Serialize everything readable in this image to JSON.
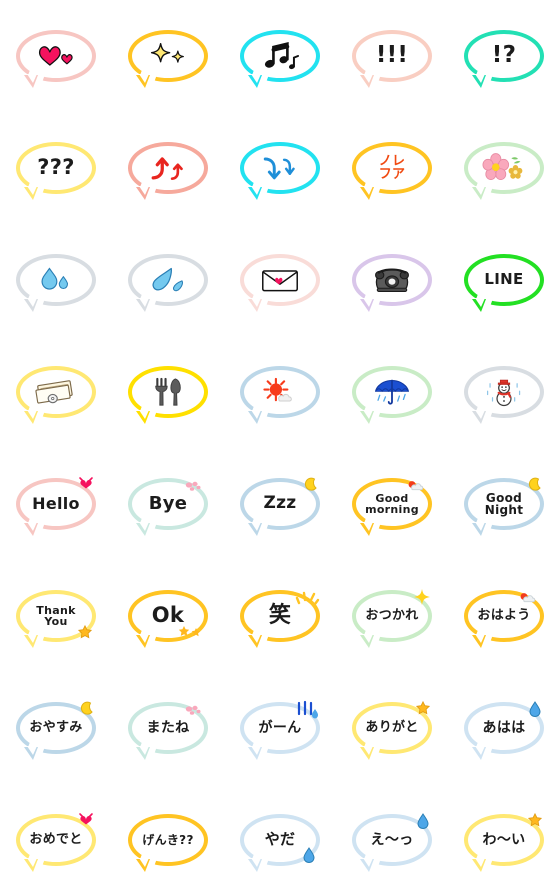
{
  "page": {
    "title": "Speech Bubble Emoji Set",
    "columns": 5,
    "rows": 8,
    "background": "#ffffff"
  },
  "palette": {
    "pink": "#f7c6c2",
    "yellow": "#ffc423",
    "cyan": "#22e2f0",
    "peach": "#f9cec2",
    "mint": "#23e0b4",
    "pale_yellow": "#ffe873",
    "salmon": "#f6a99c",
    "orange": "#f5a623",
    "pale_green": "#c9ecc6",
    "grey": "#d8dde2",
    "lavender": "#d9c6ea",
    "green": "#23e023",
    "blue_grey": "#bcd7e8",
    "sky": "#cfe3f2",
    "red": "#e8251f",
    "heart_pink": "#f5125e",
    "drop_blue": "#74c9ef",
    "note_black": "#111111",
    "star_yellow": "#ffd21e",
    "text_black": "#1c1c1c",
    "umbrella_blue": "#1b4fd1",
    "sun_red": "#f73b1b"
  },
  "stickers": [
    {
      "row": 1,
      "col": 1,
      "name": "hearts",
      "border": "#f7c6c2",
      "kind": "icon",
      "icon": "double-heart-icon",
      "label": "♥♥",
      "alt": "two pink hearts"
    },
    {
      "row": 1,
      "col": 2,
      "name": "sparkle",
      "border": "#ffc423",
      "kind": "icon",
      "icon": "sparkle-icon",
      "label": "✦✧",
      "alt": "yellow sparkles"
    },
    {
      "row": 1,
      "col": 3,
      "name": "music-notes",
      "border": "#22e2f0",
      "kind": "icon",
      "icon": "music-note-icon",
      "label": "♫♪",
      "alt": "black music notes"
    },
    {
      "row": 1,
      "col": 4,
      "name": "exclamations",
      "border": "#f9cec2",
      "kind": "text",
      "text": "!!!",
      "size": 23,
      "font": "en"
    },
    {
      "row": 1,
      "col": 5,
      "name": "interrobang",
      "border": "#23e0b4",
      "kind": "text",
      "text": "!?",
      "size": 23,
      "font": "en"
    },
    {
      "row": 2,
      "col": 1,
      "name": "questions",
      "border": "#ffe873",
      "kind": "text",
      "text": "???",
      "size": 21,
      "font": "en"
    },
    {
      "row": 2,
      "col": 2,
      "name": "up-arrows",
      "border": "#f6a99c",
      "kind": "icon",
      "icon": "up-arrow-icon",
      "label": "↑↑",
      "alt": "red up arrows"
    },
    {
      "row": 2,
      "col": 3,
      "name": "down-arrows",
      "border": "#22e2f0",
      "kind": "icon",
      "icon": "down-arrow-icon",
      "label": "↓↓",
      "alt": "blue down arrows"
    },
    {
      "row": 2,
      "col": 4,
      "name": "fufu-laugh",
      "border": "#ffc423",
      "kind": "text",
      "text": "ノレ\nフア",
      "size": 13,
      "font": "jp",
      "color": "#f04a12"
    },
    {
      "row": 2,
      "col": 5,
      "name": "flower",
      "border": "#c9ecc6",
      "kind": "icon",
      "icon": "flower-icon",
      "label": "✿",
      "alt": "pink flower"
    },
    {
      "row": 3,
      "col": 1,
      "name": "water-drops",
      "border": "#d8dde2",
      "kind": "icon",
      "icon": "water-drop-icon",
      "label": "💧",
      "alt": "blue water drops"
    },
    {
      "row": 3,
      "col": 2,
      "name": "splash-drop",
      "border": "#d8dde2",
      "kind": "icon",
      "icon": "splash-icon",
      "label": "💦",
      "alt": "blue splash"
    },
    {
      "row": 3,
      "col": 3,
      "name": "mail",
      "border": "#f9dcd8",
      "kind": "icon",
      "icon": "envelope-icon",
      "label": "✉",
      "alt": "envelope with heart"
    },
    {
      "row": 3,
      "col": 4,
      "name": "telephone",
      "border": "#d9c6ea",
      "kind": "icon",
      "icon": "telephone-icon",
      "label": "☎",
      "alt": "black rotary phone"
    },
    {
      "row": 3,
      "col": 5,
      "name": "line-logo",
      "border": "#23e023",
      "kind": "text",
      "text": "LINE",
      "size": 15,
      "font": "en"
    },
    {
      "row": 4,
      "col": 1,
      "name": "money",
      "border": "#ffe873",
      "kind": "icon",
      "icon": "money-icon",
      "label": "💴",
      "alt": "banknotes and coin"
    },
    {
      "row": 4,
      "col": 2,
      "name": "cutlery",
      "border": "#ffe000",
      "kind": "icon",
      "icon": "cutlery-icon",
      "label": "🍴",
      "alt": "fork and knife"
    },
    {
      "row": 4,
      "col": 3,
      "name": "sunny",
      "border": "#bcd7e8",
      "kind": "icon",
      "icon": "sun-icon",
      "label": "☀",
      "alt": "red sun with cloud"
    },
    {
      "row": 4,
      "col": 4,
      "name": "rainy",
      "border": "#c9ecc6",
      "kind": "icon",
      "icon": "umbrella-icon",
      "label": "☂",
      "alt": "blue umbrella with rain"
    },
    {
      "row": 4,
      "col": 5,
      "name": "snowman",
      "border": "#d8dde2",
      "kind": "icon",
      "icon": "snowman-icon",
      "label": "⛄",
      "alt": "snowman with red hat"
    },
    {
      "row": 5,
      "col": 1,
      "name": "hello",
      "border": "#f7c6c2",
      "kind": "text",
      "text": "Hello",
      "size": 16,
      "font": "en",
      "deco": "ribbon",
      "deco_pos": "tr"
    },
    {
      "row": 5,
      "col": 2,
      "name": "bye",
      "border": "#c9e8e0",
      "kind": "text",
      "text": "Bye",
      "size": 18,
      "font": "en",
      "deco": "petals",
      "deco_pos": "tr2"
    },
    {
      "row": 5,
      "col": 3,
      "name": "zzz",
      "border": "#bcd7e8",
      "kind": "text",
      "text": "Zzz",
      "size": 17,
      "font": "en",
      "deco": "moon",
      "deco_pos": "tr"
    },
    {
      "row": 5,
      "col": 4,
      "name": "good-morning",
      "border": "#ffc423",
      "kind": "text",
      "text": "Good\nmorning",
      "size": 11,
      "font": "en",
      "deco": "sun",
      "deco_pos": "tr2"
    },
    {
      "row": 5,
      "col": 5,
      "name": "good-night",
      "border": "#bcd7e8",
      "kind": "text",
      "text": "Good\nNight",
      "size": 12,
      "font": "en",
      "deco": "moon",
      "deco_pos": "tr"
    },
    {
      "row": 6,
      "col": 1,
      "name": "thank-you",
      "border": "#ffe873",
      "kind": "text",
      "text": "Thank\nYou",
      "size": 11,
      "font": "en",
      "deco": "star",
      "deco_pos": "br"
    },
    {
      "row": 6,
      "col": 2,
      "name": "ok",
      "border": "#ffc423",
      "kind": "text",
      "text": "Ok",
      "size": 21,
      "font": "en",
      "deco": "stars2",
      "deco_pos": "br"
    },
    {
      "row": 6,
      "col": 3,
      "name": "warai-laugh",
      "border": "#ffc423",
      "kind": "text",
      "text": "笑",
      "size": 22,
      "font": "jp",
      "deco": "burst",
      "deco_pos": "tr"
    },
    {
      "row": 6,
      "col": 4,
      "name": "otsukare",
      "border": "#c9ecc6",
      "kind": "text",
      "text": "おつかれ",
      "size": 13,
      "font": "jp",
      "deco": "sparkle",
      "deco_pos": "tr"
    },
    {
      "row": 6,
      "col": 5,
      "name": "ohayou",
      "border": "#ffc423",
      "kind": "text",
      "text": "おはよう",
      "size": 13,
      "font": "jp",
      "deco": "sun",
      "deco_pos": "tr2"
    },
    {
      "row": 7,
      "col": 1,
      "name": "oyasumi",
      "border": "#bcd7e8",
      "kind": "text",
      "text": "おやすみ",
      "size": 13,
      "font": "jp",
      "deco": "moon",
      "deco_pos": "tr"
    },
    {
      "row": 7,
      "col": 2,
      "name": "matane",
      "border": "#c9e8e0",
      "kind": "text",
      "text": "またね",
      "size": 14,
      "font": "jp",
      "deco": "petals",
      "deco_pos": "tr2"
    },
    {
      "row": 7,
      "col": 3,
      "name": "gaan-shock",
      "border": "#cfe3f2",
      "kind": "text",
      "text": "がーん",
      "size": 14,
      "font": "jp",
      "deco": "shock",
      "deco_pos": "tr"
    },
    {
      "row": 7,
      "col": 4,
      "name": "arigato",
      "border": "#ffe873",
      "kind": "text",
      "text": "ありがと",
      "size": 13,
      "font": "jp",
      "deco": "star",
      "deco_pos": "tr"
    },
    {
      "row": 7,
      "col": 5,
      "name": "ahaha",
      "border": "#cfe3f2",
      "kind": "text",
      "text": "あはは",
      "size": 14,
      "font": "jp",
      "deco": "sweat",
      "deco_pos": "tr"
    },
    {
      "row": 8,
      "col": 1,
      "name": "omedeto",
      "border": "#ffe873",
      "kind": "text",
      "text": "おめでと",
      "size": 13,
      "font": "jp",
      "deco": "ribbon",
      "deco_pos": "tr"
    },
    {
      "row": 8,
      "col": 2,
      "name": "genki",
      "border": "#ffc423",
      "kind": "text",
      "text": "げんき??",
      "size": 12,
      "font": "jp"
    },
    {
      "row": 8,
      "col": 3,
      "name": "yada",
      "border": "#cfe3f2",
      "kind": "text",
      "text": "やだ",
      "size": 15,
      "font": "jp",
      "deco": "sweat",
      "deco_pos": "br"
    },
    {
      "row": 8,
      "col": 4,
      "name": "eeh",
      "border": "#cfe3f2",
      "kind": "text",
      "text": "え〜っ",
      "size": 14,
      "font": "jp",
      "deco": "sweat",
      "deco_pos": "tr"
    },
    {
      "row": 8,
      "col": 5,
      "name": "wai",
      "border": "#ffe873",
      "kind": "text",
      "text": "わ〜い",
      "size": 14,
      "font": "jp",
      "deco": "star",
      "deco_pos": "tr"
    }
  ]
}
